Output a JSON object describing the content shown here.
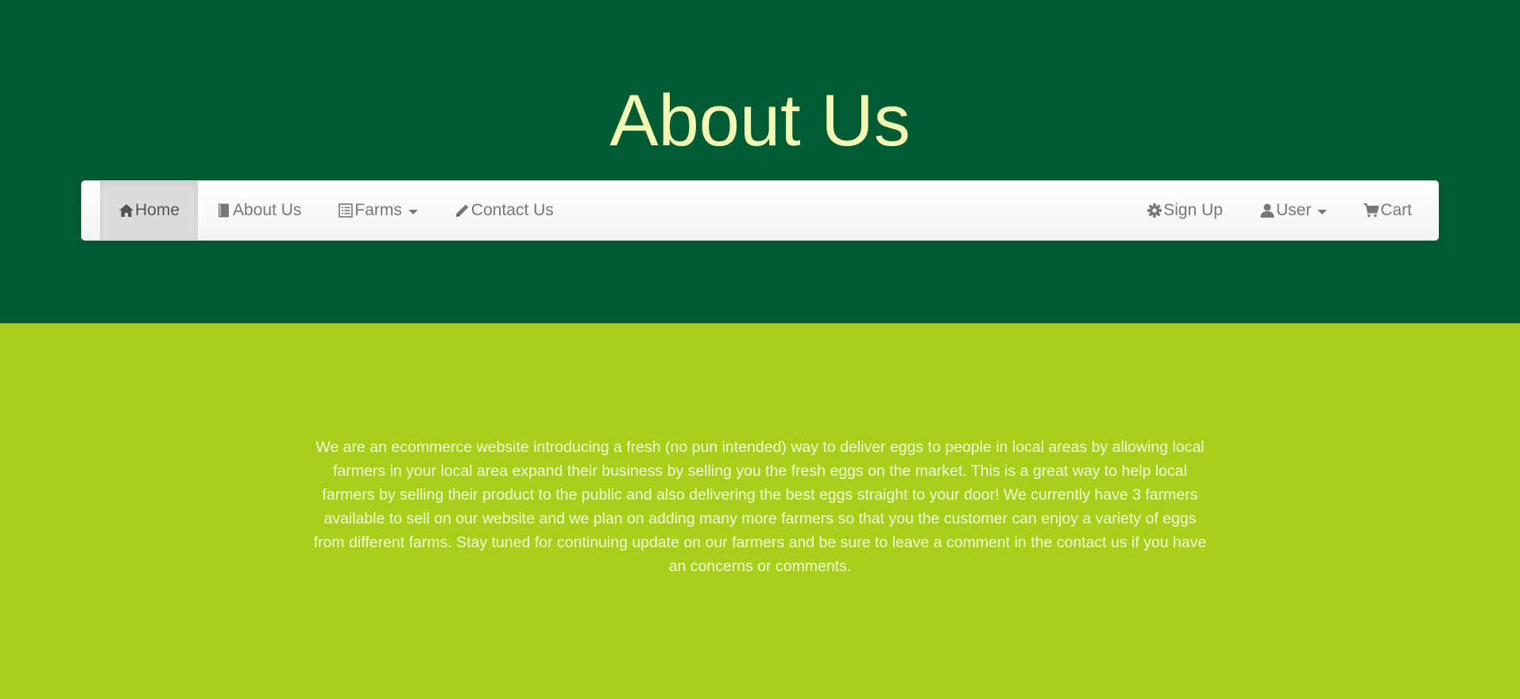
{
  "header": {
    "title": "About Us"
  },
  "nav": {
    "left": [
      {
        "label": "Home",
        "icon": "home-icon",
        "active": true
      },
      {
        "label": "About Us",
        "icon": "book-icon"
      },
      {
        "label": "Farms",
        "icon": "list-icon",
        "dropdown": true
      },
      {
        "label": "Contact Us",
        "icon": "pencil-icon"
      }
    ],
    "right": [
      {
        "label": "Sign Up",
        "icon": "gear-icon"
      },
      {
        "label": "User",
        "icon": "user-icon",
        "dropdown": true
      },
      {
        "label": "Cart",
        "icon": "cart-icon"
      }
    ]
  },
  "main": {
    "about_text": "We are an ecommerce website introducing a fresh (no pun intended) way to deliver eggs to people in local areas by allowing local farmers in your local area expand their business by selling you the fresh eggs on the market. This is a great way to help local farmers by selling their product to the public and also delivering the best eggs straight to your door! We currently have 3 farmers available to sell on our website and we plan on adding many more farmers so that you the customer can enjoy a variety of eggs from different farms. Stay tuned for continuing update on our farmers and be sure to leave a comment in the contact us if you have an concerns or comments."
  },
  "colors": {
    "header_bg": "#005a32",
    "title_color": "#f2f9b4",
    "content_bg": "#a8cf19",
    "content_text": "#f2f9d8",
    "nav_text": "#777777"
  }
}
